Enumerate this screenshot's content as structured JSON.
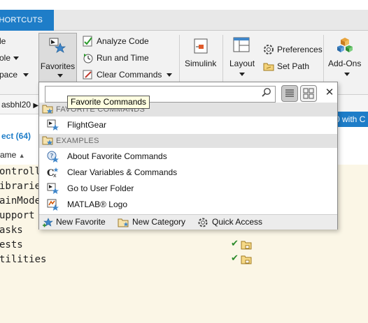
{
  "tabs": {
    "shortcuts_label": "SHORTCUTS"
  },
  "ribbon": {
    "left_partial_items": [
      "le",
      "ole",
      "pace"
    ],
    "favorites_label": "Favorites",
    "analyze_code": "Analyze Code",
    "run_and_time": "Run and Time",
    "clear_commands": "Clear Commands",
    "simulink": "Simulink",
    "layout": "Layout",
    "preferences": "Preferences",
    "set_path": "Set Path",
    "add_ons": "Add-Ons"
  },
  "address": {
    "path_fragment": "asbhl20",
    "right_button": "0 with C"
  },
  "current_folder": {
    "title": "ect (64)",
    "name_column": "ame",
    "files": [
      "ontrolle",
      "ibraries",
      "ainMode",
      "upport",
      "asks",
      "ests",
      "tilities"
    ]
  },
  "popup": {
    "search_placeholder": "",
    "tooltip": "Favorite Commands",
    "categories": [
      {
        "name": "FAVORITE COMMANDS",
        "items": [
          "FlightGear"
        ]
      },
      {
        "name": "EXAMPLES",
        "items": [
          "About Favorite Commands",
          "Clear Variables & Commands",
          "Go to User Folder",
          "MATLAB® Logo"
        ]
      }
    ],
    "footer": {
      "new_favorite": "New Favorite",
      "new_category": "New Category",
      "quick_access": "Quick Access"
    }
  },
  "colors": {
    "accent": "#1e7dc8",
    "file_panel_bg": "#fbf6e6",
    "tooltip_bg": "#ffffe1"
  }
}
